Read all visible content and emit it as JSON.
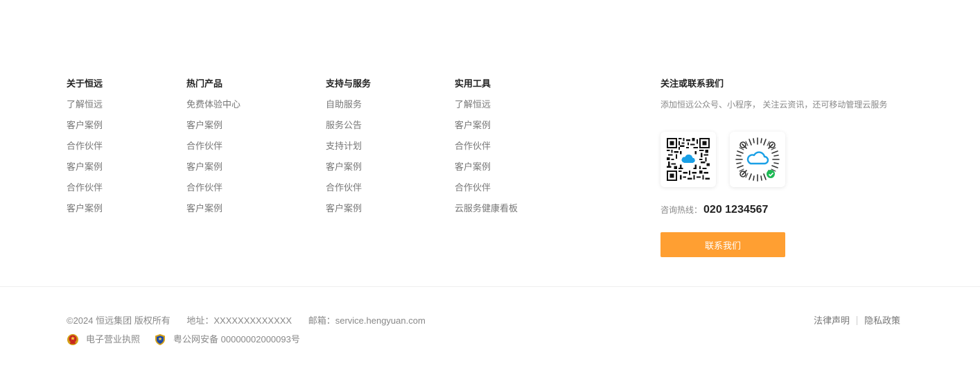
{
  "columns": [
    {
      "title": "关于恒远",
      "items": [
        "了解恒远",
        "客户案例",
        "合作伙伴",
        "客户案例",
        "合作伙伴",
        "客户案例"
      ]
    },
    {
      "title": "热门产品",
      "items": [
        "免费体验中心",
        "客户案例",
        "合作伙伴",
        "客户案例",
        "合作伙伴",
        "客户案例"
      ]
    },
    {
      "title": "支持与服务",
      "items": [
        "自助服务",
        "服务公告",
        "支持计划",
        "客户案例",
        "合作伙伴",
        "客户案例"
      ]
    },
    {
      "title": "实用工具",
      "items": [
        "了解恒远",
        "客户案例",
        "合作伙伴",
        "客户案例",
        "合作伙伴",
        "云服务健康看板"
      ]
    }
  ],
  "contact": {
    "title": "关注或联系我们",
    "description": "添加恒远公众号、小程序， 关注云资讯，还可移动管理云服务",
    "qr_codes": [
      "qr-code-icon",
      "mini-program-code-icon"
    ],
    "hotline_label": "咨询热线：",
    "hotline_number": "020 1234567",
    "button_label": "联系我们",
    "accent_color": "#ff9f32"
  },
  "footer": {
    "copyright": "©2024 恒远集团 版权所有",
    "address": "地址：XXXXXXXXXXXXX",
    "email": "邮箱：service.hengyuan.com",
    "license": "电子营业执照",
    "police_record": "粤公网安备 00000002000093号",
    "legal": "法律声明",
    "privacy": "隐私政策"
  }
}
